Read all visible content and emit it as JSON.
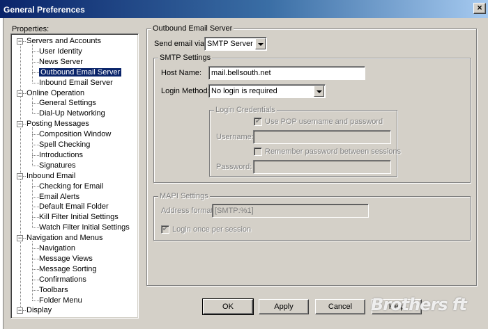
{
  "window": {
    "title": "General Preferences",
    "close_glyph": "×"
  },
  "properties_label": "Properties:",
  "tree": [
    {
      "label": "Servers and Accounts",
      "level": 0,
      "expander": "−"
    },
    {
      "label": "User Identity",
      "level": 1
    },
    {
      "label": "News Server",
      "level": 1
    },
    {
      "label": "Outbound Email Server",
      "level": 1,
      "selected": true
    },
    {
      "label": "Inbound Email Server",
      "level": 1
    },
    {
      "label": "Online Operation",
      "level": 0,
      "expander": "−"
    },
    {
      "label": "General Settings",
      "level": 1
    },
    {
      "label": "Dial-Up Networking",
      "level": 1
    },
    {
      "label": "Posting Messages",
      "level": 0,
      "expander": "−"
    },
    {
      "label": "Composition Window",
      "level": 1
    },
    {
      "label": "Spell Checking",
      "level": 1
    },
    {
      "label": "Introductions",
      "level": 1
    },
    {
      "label": "Signatures",
      "level": 1
    },
    {
      "label": "Inbound Email",
      "level": 0,
      "expander": "−"
    },
    {
      "label": "Checking for Email",
      "level": 1
    },
    {
      "label": "Email Alerts",
      "level": 1
    },
    {
      "label": "Default Email Folder",
      "level": 1
    },
    {
      "label": "Kill Filter Initial Settings",
      "level": 1
    },
    {
      "label": "Watch Filter Initial Settings",
      "level": 1
    },
    {
      "label": "Navigation and Menus",
      "level": 0,
      "expander": "−"
    },
    {
      "label": "Navigation",
      "level": 1
    },
    {
      "label": "Message Views",
      "level": 1
    },
    {
      "label": "Message Sorting",
      "level": 1
    },
    {
      "label": "Confirmations",
      "level": 1
    },
    {
      "label": "Toolbars",
      "level": 1
    },
    {
      "label": "Folder Menu",
      "level": 1
    },
    {
      "label": "Display",
      "level": 0,
      "expander": "−"
    }
  ],
  "outbound": {
    "group_label": "Outbound Email Server",
    "send_via_label": "Send email via:",
    "send_via_value": "SMTP Server",
    "smtp": {
      "group_label": "SMTP Settings",
      "host_label": "Host Name:",
      "host_value": "mail.bellsouth.net",
      "login_method_label": "Login Method:",
      "login_method_value": "No login is required",
      "credentials": {
        "group_label": "Login Credentials",
        "use_pop_label": "Use POP username and password",
        "use_pop_checked": true,
        "username_label": "Username:",
        "username_value": "",
        "remember_label": "Remember password between sessions",
        "remember_checked": false,
        "password_label": "Password:",
        "password_value": ""
      }
    },
    "mapi": {
      "group_label": "MAPI Settings",
      "address_format_label": "Address format:",
      "address_format_value": "[SMTP:%1]",
      "login_once_label": "Login once per session",
      "login_once_checked": true
    }
  },
  "buttons": {
    "ok": "OK",
    "apply": "Apply",
    "cancel": "Cancel",
    "help": "Help"
  },
  "check_glyph": "✔",
  "watermark": "Brothers ft"
}
